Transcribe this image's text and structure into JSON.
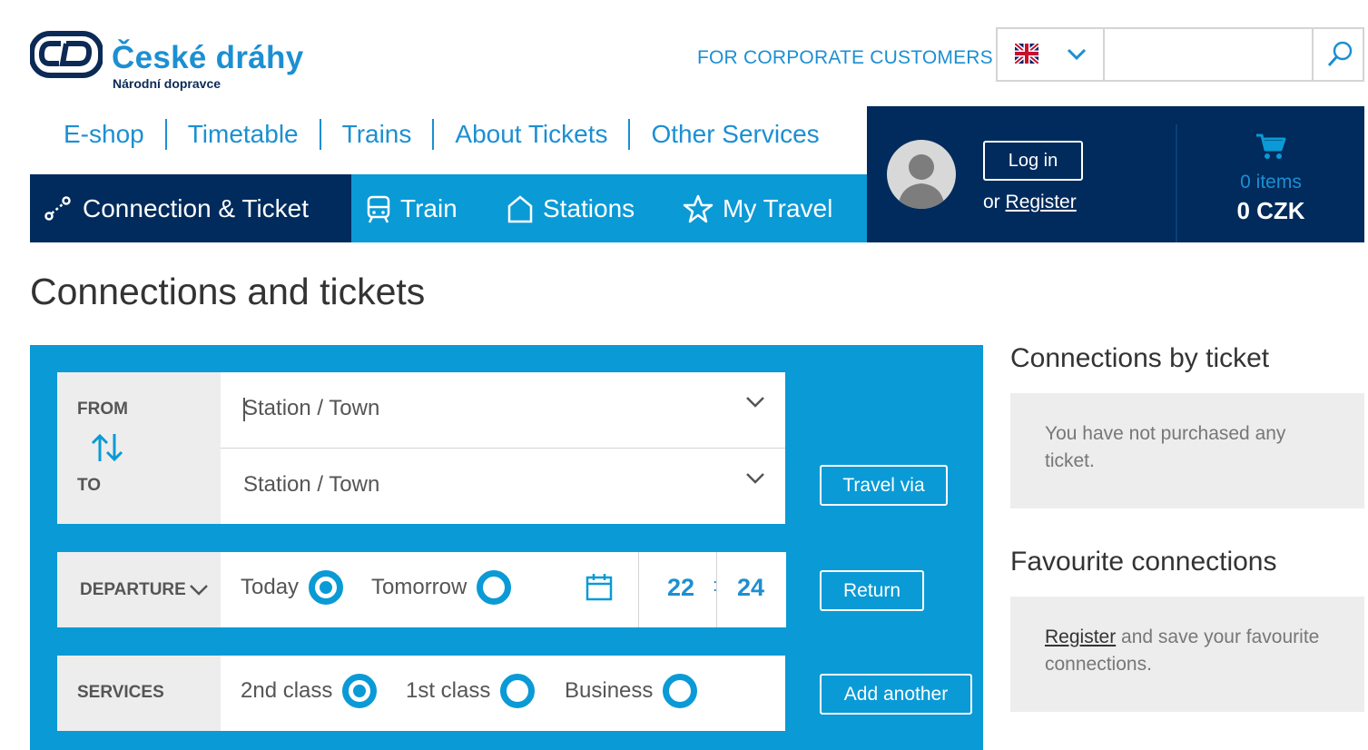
{
  "brand": {
    "name": "České dráhy",
    "tagline": "Národní dopravce"
  },
  "header": {
    "corporate_link": "FOR CORPORATE CUSTOMERS",
    "language_flag": "uk-flag-icon",
    "search": {
      "placeholder": "",
      "value": ""
    }
  },
  "top_nav": [
    "E-shop",
    "Timetable",
    "Trains",
    "About Tickets",
    "Other Services"
  ],
  "main_nav": {
    "tabs": [
      {
        "label": "Connection & Ticket",
        "icon": "route-icon",
        "active": true
      },
      {
        "label": "Train",
        "icon": "train-icon",
        "active": false
      },
      {
        "label": "Stations",
        "icon": "station-house-icon",
        "active": false
      },
      {
        "label": "My Travel",
        "icon": "star-icon",
        "active": false
      }
    ]
  },
  "account": {
    "login_label": "Log in",
    "or_text": "or",
    "register_label": "Register"
  },
  "cart": {
    "items": "0 items",
    "total": "0 CZK"
  },
  "page_title": "Connections and tickets",
  "search_form": {
    "from_label": "FROM",
    "to_label": "TO",
    "from_placeholder": "Station / Town",
    "to_placeholder": "Station / Town",
    "travel_via_label": "Travel via",
    "departure_label": "DEPARTURE",
    "day_options": [
      {
        "label": "Today",
        "selected": true
      },
      {
        "label": "Tomorrow",
        "selected": false
      }
    ],
    "hour": "22",
    "minute": "24",
    "time_separator": ":",
    "return_label": "Return",
    "services_label": "SERVICES",
    "class_options": [
      {
        "label": "2nd class",
        "selected": true
      },
      {
        "label": "1st class",
        "selected": false
      },
      {
        "label": "Business",
        "selected": false
      }
    ],
    "add_another_label": "Add another"
  },
  "sidebar": {
    "tickets_title": "Connections by ticket",
    "tickets_empty": "You have not purchased any ticket.",
    "favourites_title": "Favourite connections",
    "favourites_register": "Register",
    "favourites_text": "and save your favourite connections."
  },
  "colors": {
    "accent": "#0a9ad6",
    "brand_blue": "#1c8fd2",
    "navy": "#002b5c",
    "panel_grey": "#ededed"
  }
}
